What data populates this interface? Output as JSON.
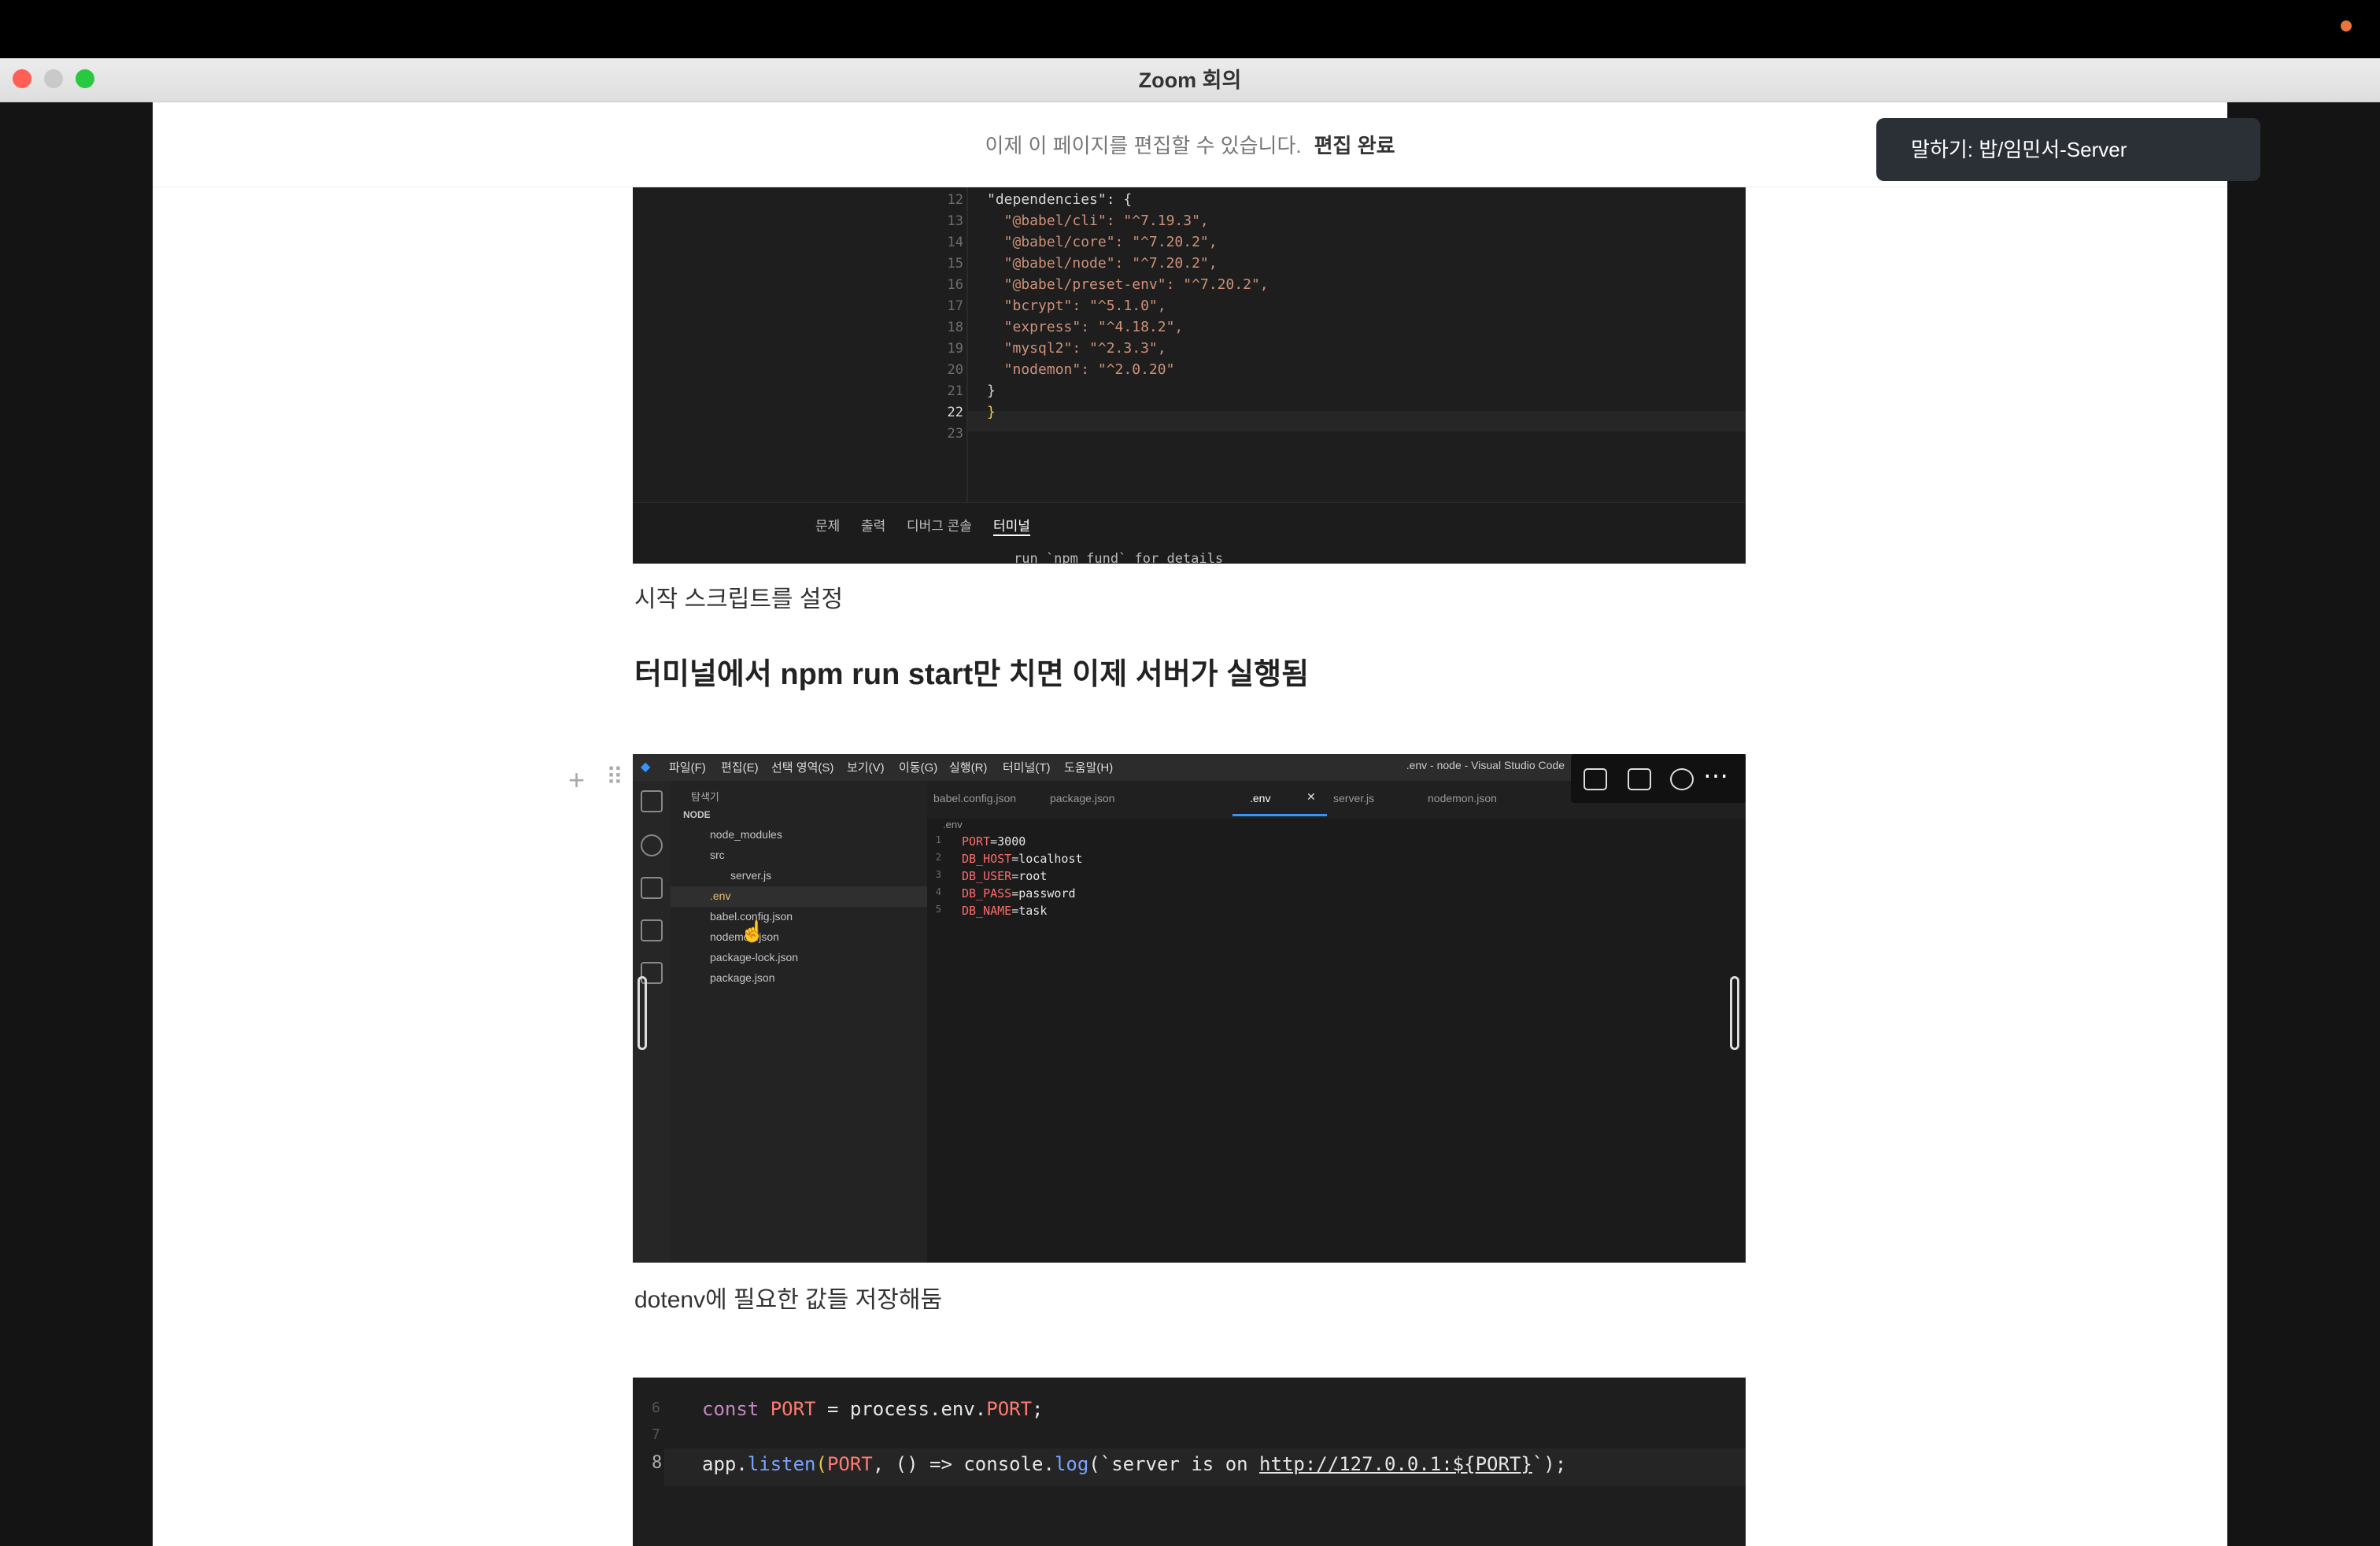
{
  "window": {
    "title": "Zoom 회의"
  },
  "editbar": {
    "message": "이제 이 페이지를 편집할 수 있습니다.",
    "done_label": "편집 완료"
  },
  "speaking": {
    "label": "말하기: 밥/임민서-Server"
  },
  "shot1": {
    "lines": [
      {
        "num": "12",
        "text": "\"dependencies\": {"
      },
      {
        "num": "13",
        "text": "  \"@babel/cli\": \"^7.19.3\","
      },
      {
        "num": "14",
        "text": "  \"@babel/core\": \"^7.20.2\","
      },
      {
        "num": "15",
        "text": "  \"@babel/node\": \"^7.20.2\","
      },
      {
        "num": "16",
        "text": "  \"@babel/preset-env\": \"^7.20.2\","
      },
      {
        "num": "17",
        "text": "  \"bcrypt\": \"^5.1.0\","
      },
      {
        "num": "18",
        "text": "  \"express\": \"^4.18.2\","
      },
      {
        "num": "19",
        "text": "  \"mysql2\": \"^2.3.3\","
      },
      {
        "num": "20",
        "text": "  \"nodemon\": \"^2.0.20\""
      },
      {
        "num": "21",
        "text": "}"
      },
      {
        "num": "22",
        "text": "}"
      },
      {
        "num": "23",
        "text": ""
      }
    ],
    "panel_tabs": [
      "문제",
      "출력",
      "디버그 콘솔",
      "터미널"
    ],
    "terminal_text": "run `npm fund` for details"
  },
  "caption1": "시작 스크립트를 설정",
  "heading1": "터미널에서 npm run start만 치면 이제 서버가 실행됨",
  "shot2": {
    "menu": [
      "파일(F)",
      "편집(E)",
      "선택 영역(S)",
      "보기(V)",
      "이동(G)",
      "실행(R)",
      "터미널(T)",
      "도움말(H)"
    ],
    "window_title": ".env - node - Visual Studio Code",
    "explorer_title": "탐색기",
    "tree": [
      "NODE",
      "node_modules",
      "src",
      "server.js",
      ".env",
      "babel.config.json",
      "nodemon.json",
      "package-lock.json",
      "package.json"
    ],
    "tabs": [
      "babel.config.json",
      "package.json",
      ".env",
      "server.js",
      "nodemon.json"
    ],
    "breadcrumb": ".env",
    "env_lines": [
      {
        "num": "1",
        "key": "PORT",
        "value": "3000"
      },
      {
        "num": "2",
        "key": "DB_HOST",
        "value": "localhost"
      },
      {
        "num": "3",
        "key": "DB_USER",
        "value": "root"
      },
      {
        "num": "4",
        "key": "DB_PASS",
        "value": "password"
      },
      {
        "num": "5",
        "key": "DB_NAME",
        "value": "task"
      }
    ]
  },
  "caption2": "dotenv에 필요한 값들 저장해둠",
  "shot3": {
    "line6_num": "6",
    "line7_num": "7",
    "line8_num": "8",
    "line6": {
      "kw": "const",
      "var": "PORT",
      "eq": " = process.env.",
      "prop": "PORT",
      "end": ";"
    },
    "line8": {
      "obj": "app.",
      "fn": "listen",
      "open": "(",
      "arg": "PORT",
      "mid": ", () => console.",
      "log": "log",
      "str": "(`server is on ",
      "url": "http://127.0.0.1:${PORT}",
      "close": "`)",
      "end": ";"
    }
  },
  "colors": {
    "accent": "#3794ff",
    "close": "#ff5f57",
    "min": "#c9c9c9",
    "max": "#28c840"
  }
}
